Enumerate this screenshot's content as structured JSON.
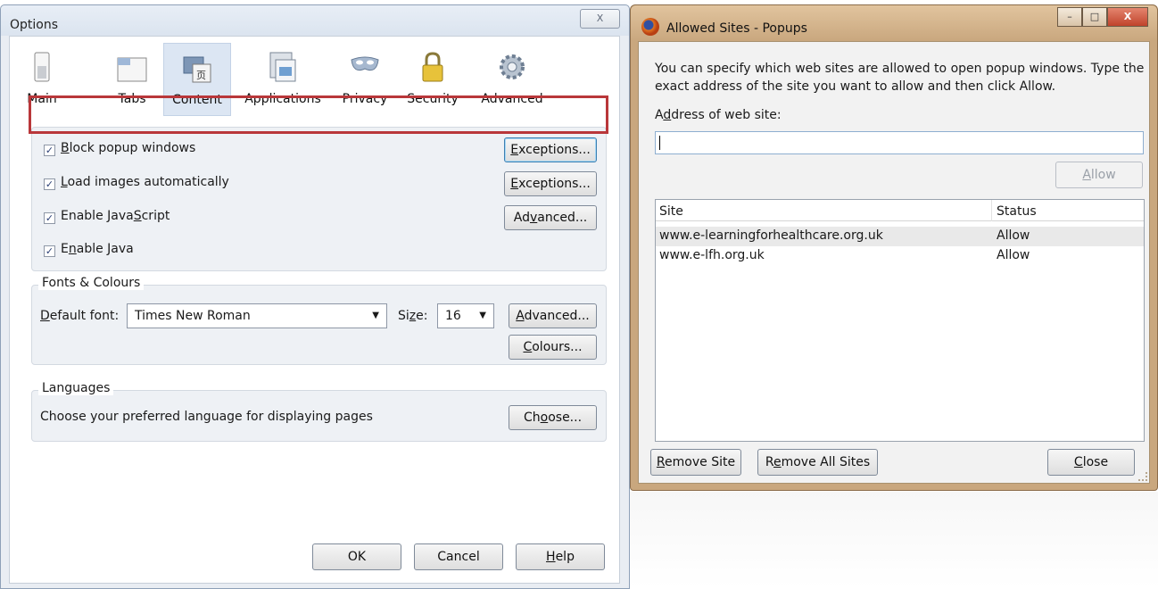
{
  "options_window": {
    "title": "Options",
    "close_glyph": "X",
    "toolbar": [
      {
        "label": "Main",
        "icon": "main-icon"
      },
      {
        "label": "Tabs",
        "icon": "tabs-icon"
      },
      {
        "label": "Content",
        "icon": "content-icon",
        "active": true
      },
      {
        "label": "Applications",
        "icon": "applications-icon"
      },
      {
        "label": "Privacy",
        "icon": "privacy-mask-icon"
      },
      {
        "label": "Security",
        "icon": "padlock-icon"
      },
      {
        "label": "Advanced",
        "icon": "gear-icon"
      }
    ],
    "content": {
      "block_popups": {
        "prefix": "",
        "accel": "B",
        "rest": "lock popup windows",
        "checked": true
      },
      "load_images": {
        "prefix": "",
        "accel": "L",
        "rest": "oad images automatically",
        "checked": true
      },
      "enable_js": {
        "prefix": "Enable Java",
        "accel": "S",
        "rest": "cript",
        "checked": true
      },
      "enable_java": {
        "prefix": "E",
        "accel": "n",
        "rest": "able Java",
        "checked": true
      },
      "exceptions_1": {
        "accel": "E",
        "rest": "xceptions..."
      },
      "exceptions_2": {
        "accel": "E",
        "rest": "xceptions..."
      },
      "advanced_js": {
        "prefix": "Ad",
        "accel": "v",
        "rest": "anced..."
      }
    },
    "fonts": {
      "caption": "Fonts & Colours",
      "default_font_accel": "D",
      "default_font_rest": "efault font:",
      "font_value": "Times New Roman",
      "size_prefix": "Si",
      "size_accel": "z",
      "size_rest": "e:",
      "size_value": "16",
      "advanced_accel": "A",
      "advanced_rest": "dvanced...",
      "colours_accel": "C",
      "colours_rest": "olours..."
    },
    "languages": {
      "caption": "Languages",
      "text": "Choose your preferred language for displaying pages",
      "choose_prefix": "Ch",
      "choose_accel": "o",
      "choose_rest": "ose..."
    },
    "buttons": {
      "ok": "OK",
      "cancel": "Cancel",
      "help_accel": "H",
      "help_rest": "elp"
    }
  },
  "popups_window": {
    "title": "Allowed Sites - Popups",
    "description": "You can specify which web sites are allowed to open popup windows. Type the exact address of the site you want to allow and then click Allow.",
    "address_label_prefix": "A",
    "address_label_accel": "d",
    "address_label_rest": "dress of web site:",
    "address_value": "",
    "allow_accel": "A",
    "allow_rest": "llow",
    "columns": {
      "site": "Site",
      "status": "Status"
    },
    "rows": [
      {
        "site": "www.e-learningforhealthcare.org.uk",
        "status": "Allow"
      },
      {
        "site": "www.e-lfh.org.uk",
        "status": "Allow"
      }
    ],
    "remove_site_accel": "R",
    "remove_site_rest": "emove Site",
    "remove_all_prefix": "R",
    "remove_all_accel": "e",
    "remove_all_rest": "move All Sites",
    "close_accel": "C",
    "close_rest": "lose",
    "caption_buttons": {
      "minimize": "–",
      "maximize": "□",
      "close": "X"
    }
  },
  "colors": {
    "highlight_box": "#b9373a",
    "active_tab": "#dce6f3",
    "popup_frame": "#c9a77e"
  }
}
